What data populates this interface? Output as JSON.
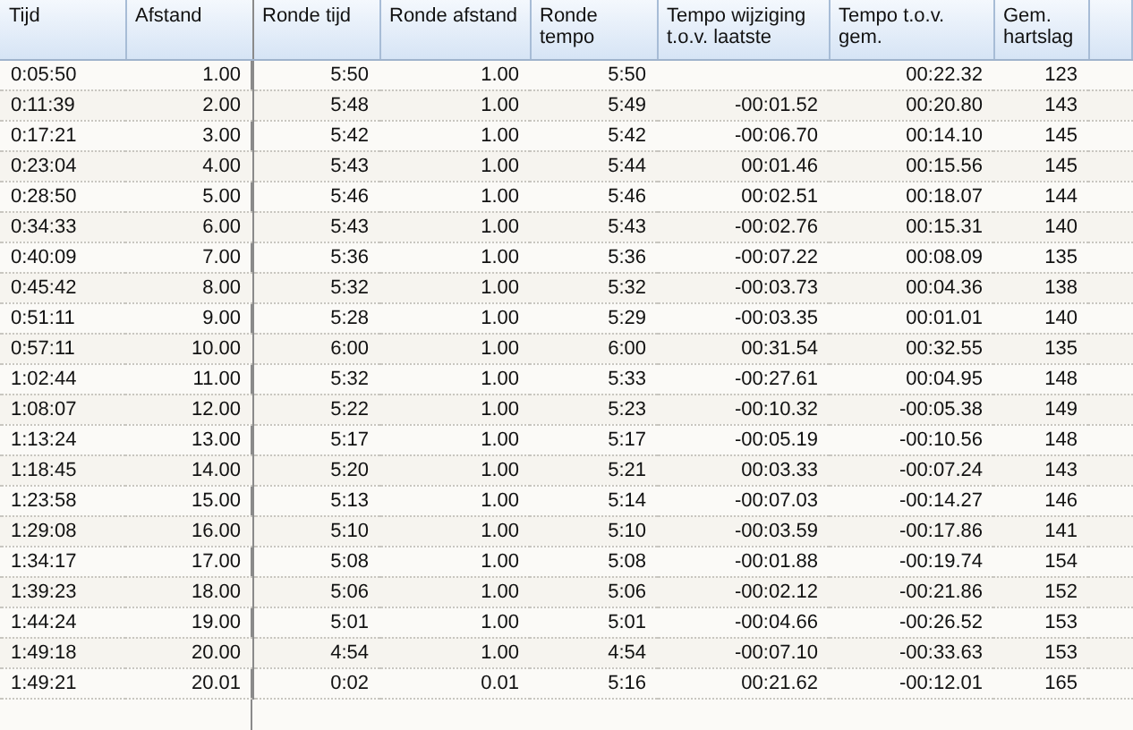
{
  "table": {
    "columns": [
      "Tijd",
      "Afstand",
      "Ronde tijd",
      "Ronde afstand",
      "Ronde\ntempo",
      "Tempo wijziging\nt.o.v. laatste",
      "Tempo t.o.v.\ngem.",
      "Gem.\nhartslag"
    ],
    "rows": [
      [
        "0:05:50",
        "1.00",
        "5:50",
        "1.00",
        "5:50",
        null,
        "00:22.32",
        "123"
      ],
      [
        "0:11:39",
        "2.00",
        "5:48",
        "1.00",
        "5:49",
        "-00:01.52",
        "00:20.80",
        "143"
      ],
      [
        "0:17:21",
        "3.00",
        "5:42",
        "1.00",
        "5:42",
        "-00:06.70",
        "00:14.10",
        "145"
      ],
      [
        "0:23:04",
        "4.00",
        "5:43",
        "1.00",
        "5:44",
        "00:01.46",
        "00:15.56",
        "145"
      ],
      [
        "0:28:50",
        "5.00",
        "5:46",
        "1.00",
        "5:46",
        "00:02.51",
        "00:18.07",
        "144"
      ],
      [
        "0:34:33",
        "6.00",
        "5:43",
        "1.00",
        "5:43",
        "-00:02.76",
        "00:15.31",
        "140"
      ],
      [
        "0:40:09",
        "7.00",
        "5:36",
        "1.00",
        "5:36",
        "-00:07.22",
        "00:08.09",
        "135"
      ],
      [
        "0:45:42",
        "8.00",
        "5:32",
        "1.00",
        "5:32",
        "-00:03.73",
        "00:04.36",
        "138"
      ],
      [
        "0:51:11",
        "9.00",
        "5:28",
        "1.00",
        "5:29",
        "-00:03.35",
        "00:01.01",
        "140"
      ],
      [
        "0:57:11",
        "10.00",
        "6:00",
        "1.00",
        "6:00",
        "00:31.54",
        "00:32.55",
        "135"
      ],
      [
        "1:02:44",
        "11.00",
        "5:32",
        "1.00",
        "5:33",
        "-00:27.61",
        "00:04.95",
        "148"
      ],
      [
        "1:08:07",
        "12.00",
        "5:22",
        "1.00",
        "5:23",
        "-00:10.32",
        "-00:05.38",
        "149"
      ],
      [
        "1:13:24",
        "13.00",
        "5:17",
        "1.00",
        "5:17",
        "-00:05.19",
        "-00:10.56",
        "148"
      ],
      [
        "1:18:45",
        "14.00",
        "5:20",
        "1.00",
        "5:21",
        "00:03.33",
        "-00:07.24",
        "143"
      ],
      [
        "1:23:58",
        "15.00",
        "5:13",
        "1.00",
        "5:14",
        "-00:07.03",
        "-00:14.27",
        "146"
      ],
      [
        "1:29:08",
        "16.00",
        "5:10",
        "1.00",
        "5:10",
        "-00:03.59",
        "-00:17.86",
        "141"
      ],
      [
        "1:34:17",
        "17.00",
        "5:08",
        "1.00",
        "5:08",
        "-00:01.88",
        "-00:19.74",
        "154"
      ],
      [
        "1:39:23",
        "18.00",
        "5:06",
        "1.00",
        "5:06",
        "-00:02.12",
        "-00:21.86",
        "152"
      ],
      [
        "1:44:24",
        "19.00",
        "5:01",
        "1.00",
        "5:01",
        "-00:04.66",
        "-00:26.52",
        "153"
      ],
      [
        "1:49:18",
        "20.00",
        "4:54",
        "1.00",
        "4:54",
        "-00:07.10",
        "-00:33.63",
        "153"
      ],
      [
        "1:49:21",
        "20.01",
        "0:02",
        "0.01",
        "5:16",
        "00:21.62",
        "-00:12.01",
        "165"
      ]
    ]
  }
}
